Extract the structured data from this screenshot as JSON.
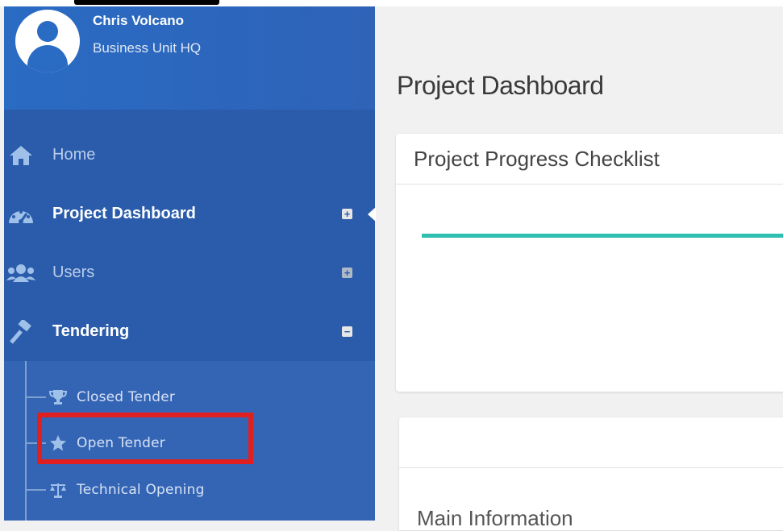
{
  "user": {
    "name": "Chris Volcano",
    "unit": "Business Unit HQ"
  },
  "nav": [
    {
      "label": "Home",
      "icon": "home-icon",
      "toggle": ""
    },
    {
      "label": "Project Dashboard",
      "icon": "dashboard-icon",
      "toggle": "+"
    },
    {
      "label": "Users",
      "icon": "users-icon",
      "toggle": "+"
    },
    {
      "label": "Tendering",
      "icon": "gavel-icon",
      "toggle": "−"
    }
  ],
  "submenu": [
    {
      "label": "Closed Tender",
      "icon": "trophy-icon"
    },
    {
      "label": "Open Tender",
      "icon": "star-icon"
    },
    {
      "label": "Technical Opening",
      "icon": "scale-icon"
    }
  ],
  "main": {
    "page_title": "Project Dashboard",
    "card1_title": "Project Progress Checklist",
    "card2_subtitle": "Main Information"
  },
  "colors": {
    "sidebar": "#2a5cab",
    "submenu": "#3465b5",
    "accent_progress": "#2fbfb0",
    "highlight": "#e02020"
  }
}
